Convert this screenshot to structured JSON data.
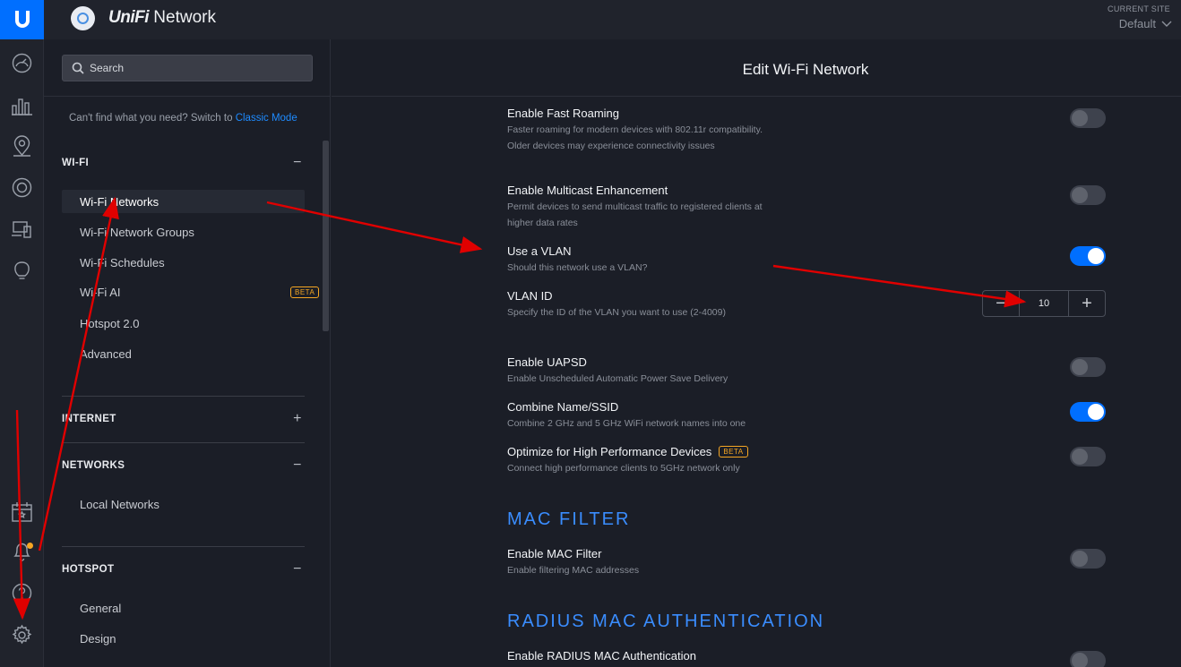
{
  "header": {
    "brand_uni": "UniFi",
    "brand_name": "Network",
    "site_label": "CURRENT SITE",
    "site_value": "Default"
  },
  "rail": {
    "icons": [
      "dashboard-icon",
      "statistics-icon",
      "map-icon",
      "devices-icon",
      "clients-icon",
      "insights-icon",
      "events-icon",
      "alerts-icon",
      "help-icon",
      "settings-icon"
    ]
  },
  "sidebar": {
    "search_placeholder": "Search",
    "classic_text": "Can't find what you need? Switch to",
    "classic_link": "Classic Mode",
    "sections": {
      "wifi": {
        "label": "WI-FI",
        "toggle": "−"
      },
      "internet": {
        "label": "INTERNET",
        "toggle": "+"
      },
      "networks": {
        "label": "NETWORKS",
        "toggle": "−"
      },
      "hotspot": {
        "label": "HOTSPOT",
        "toggle": "−"
      }
    },
    "wifi_items": [
      "Wi-Fi Networks",
      "Wi-Fi Network Groups",
      "Wi-Fi Schedules",
      "Wi-Fi AI",
      "Hotspot 2.0",
      "Advanced"
    ],
    "wifi_ai_badge": "BETA",
    "network_items": [
      "Local Networks"
    ],
    "hotspot_items": [
      "General",
      "Design"
    ]
  },
  "main": {
    "title": "Edit Wi-Fi Network",
    "options": {
      "fast_roaming": {
        "title": "Enable Fast Roaming",
        "desc": "Faster roaming for modern devices with 802.11r compatibility. Older devices may experience connectivity issues",
        "enabled": false
      },
      "multicast": {
        "title": "Enable Multicast Enhancement",
        "desc": "Permit devices to send multicast traffic to registered clients at higher data rates",
        "enabled": false
      },
      "vlan": {
        "title": "Use a VLAN",
        "desc": "Should this network use a VLAN?",
        "enabled": true
      },
      "vlan_id": {
        "title": "VLAN ID",
        "desc": "Specify the ID of the VLAN you want to use (2-4009)",
        "value": "10",
        "minus": "−",
        "plus": "+"
      },
      "uapsd": {
        "title": "Enable UAPSD",
        "desc": "Enable Unscheduled Automatic Power Save Delivery",
        "enabled": false
      },
      "combine": {
        "title": "Combine Name/SSID",
        "desc": "Combine 2 GHz and 5 GHz WiFi network names into one",
        "enabled": true
      },
      "high_perf": {
        "title": "Optimize for High Performance Devices",
        "badge": "BETA",
        "desc": "Connect high performance clients to 5GHz network only",
        "enabled": false
      },
      "mac_filter_section": "MAC FILTER",
      "mac_filter": {
        "title": "Enable MAC Filter",
        "desc": "Enable filtering MAC addresses",
        "enabled": false
      },
      "radius_section": "RADIUS MAC AUTHENTICATION",
      "radius": {
        "title": "Enable RADIUS MAC Authentication",
        "enabled": false
      }
    }
  },
  "colors": {
    "accent": "#006fff",
    "section_title": "#3a8dff",
    "beta": "#f5a623",
    "annotation": "#e00000"
  }
}
